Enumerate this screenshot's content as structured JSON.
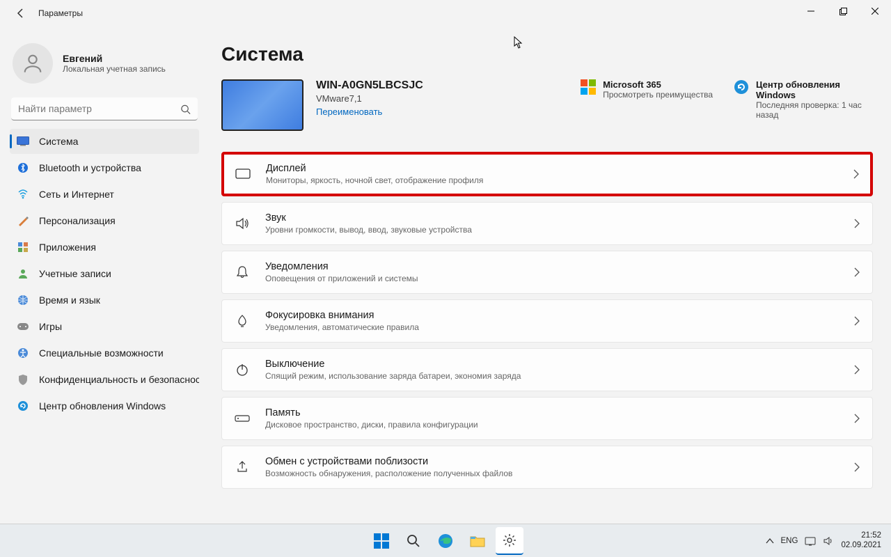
{
  "window": {
    "title": "Параметры"
  },
  "user": {
    "name": "Евгений",
    "account_type": "Локальная учетная запись"
  },
  "search": {
    "placeholder": "Найти параметр"
  },
  "sidebar": {
    "items": [
      {
        "label": "Система",
        "selected": true
      },
      {
        "label": "Bluetooth и устройства"
      },
      {
        "label": "Сеть и Интернет"
      },
      {
        "label": "Персонализация"
      },
      {
        "label": "Приложения"
      },
      {
        "label": "Учетные записи"
      },
      {
        "label": "Время и язык"
      },
      {
        "label": "Игры"
      },
      {
        "label": "Специальные возможности"
      },
      {
        "label": "Конфиденциальность и безопасность"
      },
      {
        "label": "Центр обновления Windows"
      }
    ]
  },
  "page": {
    "title": "Система"
  },
  "device": {
    "name": "WIN-A0GN5LBCSJC",
    "model": "VMware7,1",
    "rename": "Переименовать"
  },
  "quicklinks": {
    "ms365": {
      "title": "Microsoft 365",
      "sub": "Просмотреть преимущества"
    },
    "update": {
      "title": "Центр обновления Windows",
      "sub": "Последняя проверка: 1 час назад"
    }
  },
  "cards": [
    {
      "title": "Дисплей",
      "sub": "Мониторы, яркость, ночной свет, отображение профиля",
      "highlight": true
    },
    {
      "title": "Звук",
      "sub": "Уровни громкости, вывод, ввод, звуковые устройства"
    },
    {
      "title": "Уведомления",
      "sub": "Оповещения от приложений и системы"
    },
    {
      "title": "Фокусировка внимания",
      "sub": "Уведомления, автоматические правила"
    },
    {
      "title": "Выключение",
      "sub": "Спящий режим, использование заряда батареи, экономия заряда"
    },
    {
      "title": "Память",
      "sub": "Дисковое пространство, диски, правила конфигурации"
    },
    {
      "title": "Обмен с устройствами поблизости",
      "sub": "Возможность обнаружения, расположение полученных файлов"
    }
  ],
  "taskbar": {
    "lang": "ENG",
    "time": "21:52",
    "date": "02.09.2021"
  }
}
